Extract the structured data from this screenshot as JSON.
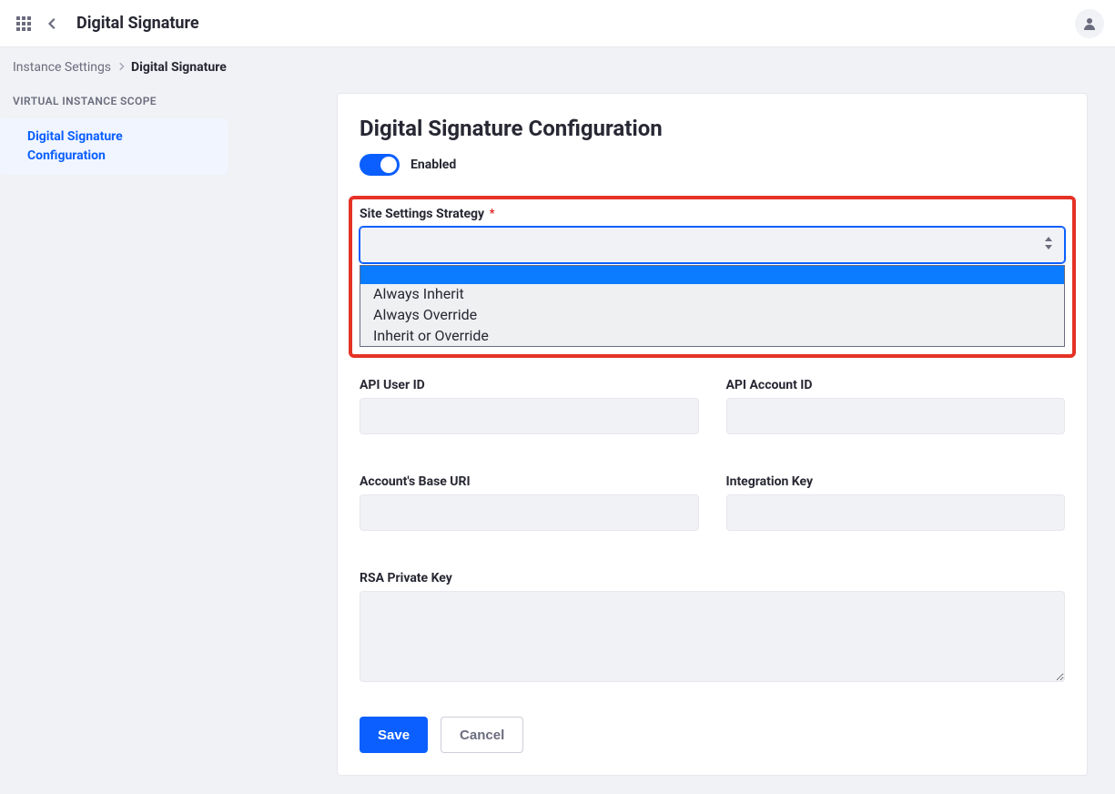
{
  "header": {
    "title": "Digital Signature"
  },
  "breadcrumbs": {
    "parent": "Instance Settings",
    "current": "Digital Signature"
  },
  "sidebar": {
    "scope_heading": "VIRTUAL INSTANCE SCOPE",
    "items": [
      {
        "label": "Digital Signature Configuration"
      }
    ]
  },
  "form": {
    "heading": "Digital Signature Configuration",
    "enabled_label": "Enabled",
    "strategy": {
      "label": "Site Settings Strategy",
      "required_mark": "*",
      "options": [
        "",
        "Always Inherit",
        "Always Override",
        "Inherit or Override"
      ]
    },
    "api_user_id_label": "API User ID",
    "api_account_id_label": "API Account ID",
    "base_uri_label": "Account's Base URI",
    "integration_key_label": "Integration Key",
    "rsa_key_label": "RSA Private Key",
    "save_label": "Save",
    "cancel_label": "Cancel"
  }
}
